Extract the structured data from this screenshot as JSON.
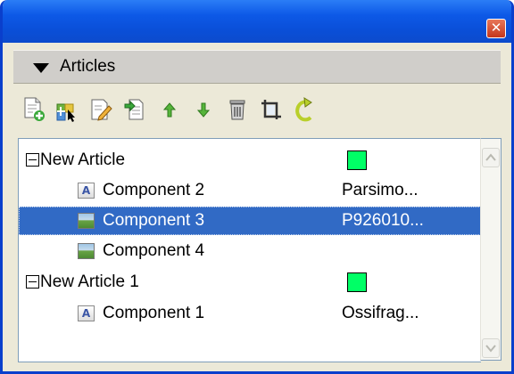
{
  "window": {
    "close_icon": "close-icon"
  },
  "panel": {
    "title": "Articles"
  },
  "toolbar": {
    "buttons": [
      {
        "name": "new-article-icon"
      },
      {
        "name": "add-component-icon"
      },
      {
        "name": "edit-icon"
      },
      {
        "name": "import-icon"
      },
      {
        "name": "move-up-icon"
      },
      {
        "name": "move-down-icon"
      },
      {
        "name": "delete-icon"
      },
      {
        "name": "crop-icon"
      },
      {
        "name": "refresh-icon"
      }
    ]
  },
  "tree": {
    "articles": [
      {
        "name": "New Article",
        "color": "#00ff66",
        "components": [
          {
            "name": "Component 2",
            "type": "text",
            "content": "Parsimo..."
          },
          {
            "name": "Component 3",
            "type": "image",
            "content": "P926010...",
            "selected": true
          },
          {
            "name": "Component 4",
            "type": "image",
            "content": ""
          }
        ]
      },
      {
        "name": "New Article 1",
        "color": "#00ff66",
        "components": [
          {
            "name": "Component 1",
            "type": "text",
            "content": "Ossifrag..."
          }
        ]
      }
    ],
    "text_icon_glyph": "A"
  },
  "colors": {
    "selection": "#316ac5",
    "titlebar": "#0d59e7",
    "article_swatch": "#00ff66"
  }
}
